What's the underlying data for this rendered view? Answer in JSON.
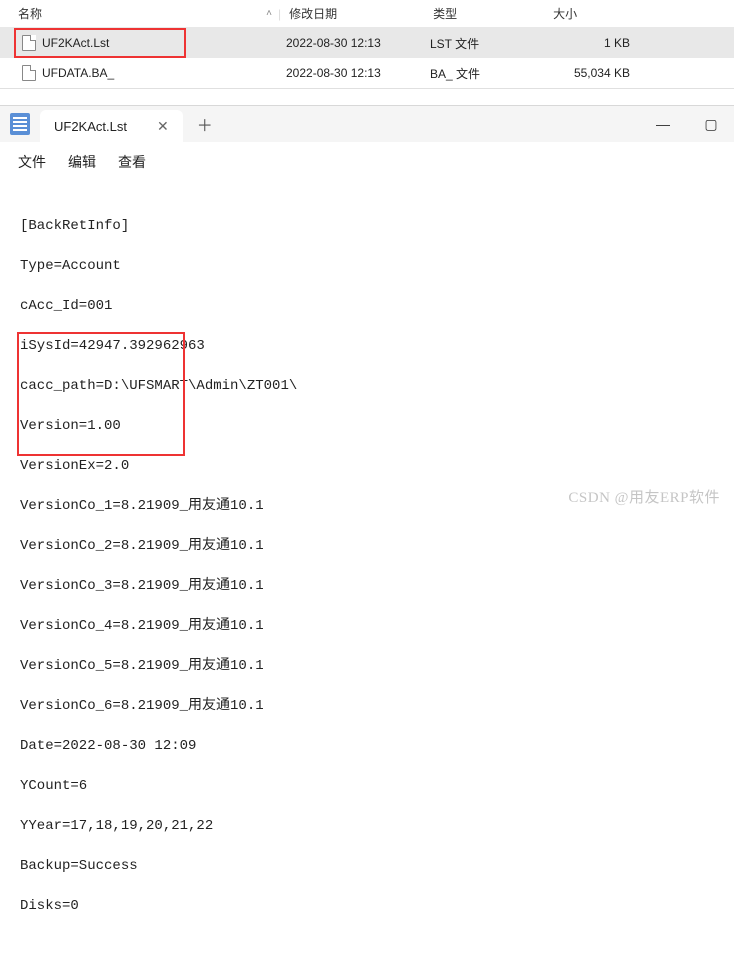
{
  "explorer": {
    "cols": {
      "name": "名称",
      "date": "修改日期",
      "type": "类型",
      "size": "大小"
    },
    "rows": [
      {
        "name": "UF2KAct.Lst",
        "date": "2022-08-30 12:13",
        "type": "LST 文件",
        "size": "1 KB"
      },
      {
        "name": "UFDATA.BA_",
        "date": "2022-08-30 12:13",
        "type": "BA_ 文件",
        "size": "55,034 KB"
      }
    ]
  },
  "editor": {
    "tab_title": "UF2KAct.Lst",
    "menu": {
      "file": "文件",
      "edit": "编辑",
      "view": "查看"
    },
    "lines": [
      "[BackRetInfo]",
      "Type=Account",
      "cAcc_Id=001",
      "iSysId=42947.392962963",
      "cacc_path=D:\\UFSMART\\Admin\\ZT001\\",
      "Version=1.00",
      "VersionEx=2.0",
      "VersionCo_1=8.21909_用友通10.1",
      "VersionCo_2=8.21909_用友通10.1",
      "VersionCo_3=8.21909_用友通10.1",
      "VersionCo_4=8.21909_用友通10.1",
      "VersionCo_5=8.21909_用友通10.1",
      "VersionCo_6=8.21909_用友通10.1",
      "Date=2022-08-30 12:09",
      "YCount=6",
      "YYear=17,18,19,20,21,22",
      "Backup=Success",
      "Disks=0"
    ]
  },
  "watermark": "CSDN @用友ERP软件"
}
